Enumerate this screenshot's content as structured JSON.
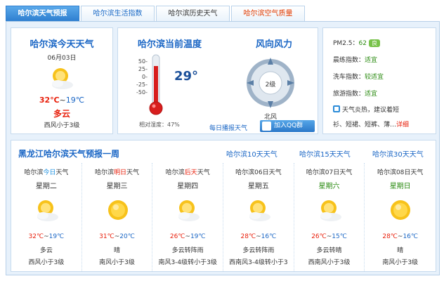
{
  "tabs": [
    {
      "label": "哈尔滨天气预报",
      "style": "active"
    },
    {
      "label": "哈尔滨生活指数",
      "style": "blue"
    },
    {
      "label": "哈尔滨历史天气",
      "style": "normal"
    },
    {
      "label": "哈尔滨空气质量",
      "style": "red"
    }
  ],
  "today": {
    "title": "哈尔滨今天天气",
    "date": "06月03日",
    "icon": "partly-cloudy-icon",
    "high": "32℃",
    "sep": "~",
    "low": "19℃",
    "condition": "多云",
    "wind": "西风小于3级"
  },
  "current": {
    "title": "哈尔滨当前温度",
    "temperature": "29°",
    "scale": [
      "50-",
      "25-",
      "0-",
      "-25-",
      "-50-"
    ],
    "humidity": "相对湿度：47%",
    "wind_title": "风向风力",
    "wind_level": "2级",
    "wind_direction": "北风",
    "daily_link": "每日播报天气",
    "qq_button": "加入QQ群"
  },
  "indices": {
    "pm_label": "PM2.5：",
    "pm_value": "62",
    "pm_level": "良",
    "items": [
      {
        "label": "晨练指数：",
        "value": "适宜"
      },
      {
        "label": "洗车指数：",
        "value": "较适宜"
      },
      {
        "label": "旅游指数：",
        "value": "适宜"
      }
    ],
    "tip_line1": "天气炎热，建议着短",
    "tip_line2": "衫、短裙、短裤、薄…",
    "detail_link": "详细"
  },
  "week": {
    "title": "黑龙江哈尔滨天气预报一周",
    "links": [
      "哈尔滨10天天气",
      "哈尔滨15天天气",
      "哈尔滨30天天气"
    ],
    "days": [
      {
        "prefix": "哈尔滨",
        "mid": "今日",
        "suffix": "天气",
        "mid_style": "hl",
        "weekday": "星期二",
        "weekday_green": false,
        "icon": "partly-cloudy-icon",
        "high": "32℃",
        "low": "19℃",
        "condition": "多云",
        "wind": "西风小于3级"
      },
      {
        "prefix": "哈尔滨",
        "mid": "明日",
        "suffix": "天气",
        "mid_style": "hl-red",
        "weekday": "星期三",
        "weekday_green": false,
        "icon": "sunny-icon",
        "high": "31℃",
        "low": "20℃",
        "condition": "晴",
        "wind": "南风小于3级"
      },
      {
        "prefix": "哈尔滨",
        "mid": "后天",
        "suffix": "天气",
        "mid_style": "hl-red",
        "weekday": "星期四",
        "weekday_green": false,
        "icon": "partly-cloudy-icon",
        "high": "26℃",
        "low": "19℃",
        "condition": "多云转阵雨",
        "wind": "南风3-4级转小于3级"
      },
      {
        "prefix": "哈尔滨",
        "mid": "06日",
        "suffix": "天气",
        "mid_style": "",
        "weekday": "星期五",
        "weekday_green": false,
        "icon": "partly-cloudy-icon",
        "high": "28℃",
        "low": "16℃",
        "condition": "多云转阵雨",
        "wind": "西南风3-4级转小于3"
      },
      {
        "prefix": "哈尔滨",
        "mid": "07日",
        "suffix": "天气",
        "mid_style": "",
        "weekday": "星期六",
        "weekday_green": true,
        "icon": "partly-cloudy-icon",
        "high": "26℃",
        "low": "15℃",
        "condition": "多云转晴",
        "wind": "西南风小于3级"
      },
      {
        "prefix": "哈尔滨",
        "mid": "08日",
        "suffix": "天气",
        "mid_style": "",
        "weekday": "星期日",
        "weekday_green": true,
        "icon": "sunny-icon",
        "high": "28℃",
        "low": "16℃",
        "condition": "晴",
        "wind": "南风小于3级"
      }
    ]
  },
  "colors": {
    "accent": "#1a66c5",
    "high": "#e8200c",
    "good": "#2a8a10",
    "background": "#e7f1fb"
  }
}
